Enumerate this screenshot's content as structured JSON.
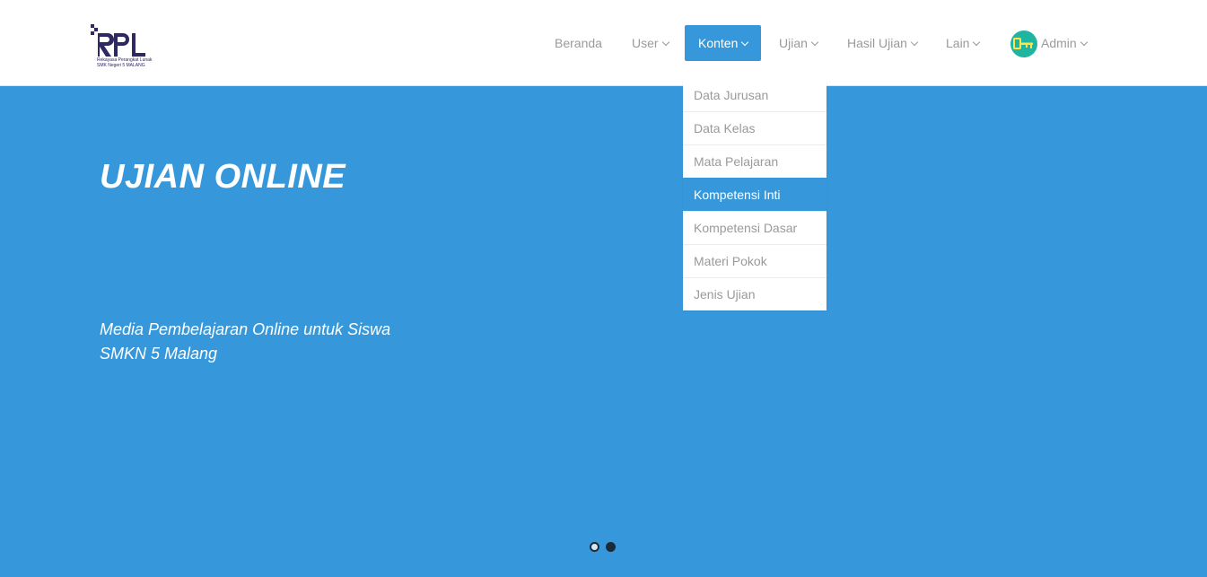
{
  "brand": {
    "logo_text": "RPL",
    "tagline": "Rekayasa Perangkat Lunak",
    "school": "SMK Negeri 5 MALANG"
  },
  "nav": {
    "items": [
      {
        "label": "Beranda"
      },
      {
        "label": "User"
      },
      {
        "label": "Konten",
        "active": true
      },
      {
        "label": "Ujian"
      },
      {
        "label": "Hasil Ujian"
      },
      {
        "label": "Lain"
      },
      {
        "label": "Admin",
        "icon": "key-icon"
      }
    ]
  },
  "dropdown": {
    "items": [
      {
        "label": "Data Jurusan"
      },
      {
        "label": "Data Kelas"
      },
      {
        "label": "Mata Pelajaran"
      },
      {
        "label": "Kompetensi Inti",
        "highlighted": true
      },
      {
        "label": "Kompetensi Dasar"
      },
      {
        "label": "Materi Pokok"
      },
      {
        "label": "Jenis Ujian"
      }
    ]
  },
  "hero": {
    "title": "UJIAN ONLINE",
    "subtitle_line1": "Media Pembelajaran Online untuk Siswa",
    "subtitle_line2": "SMKN 5 Malang"
  },
  "carousel": {
    "slide_count": 2,
    "active_index": 0
  },
  "colors": {
    "primary": "#3698db",
    "nav_text": "#9a9a9a",
    "brand": "#2e2863",
    "avatar": "#1fb5a1",
    "key": "#ffe34d"
  }
}
